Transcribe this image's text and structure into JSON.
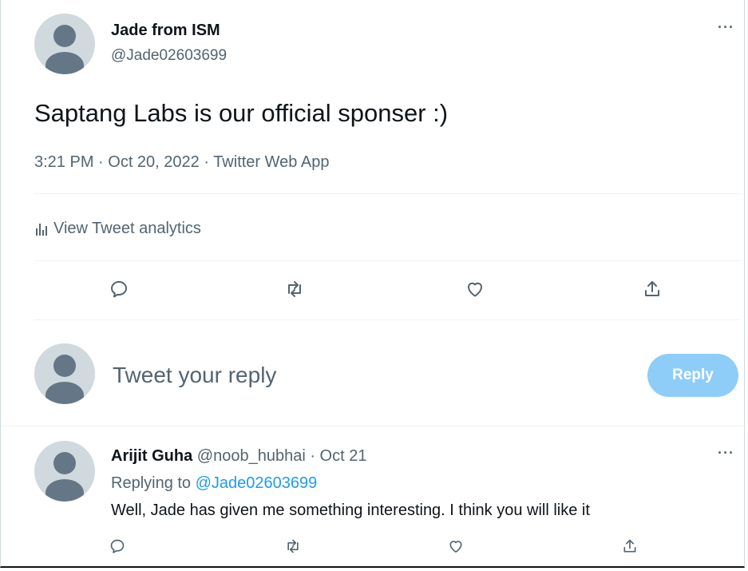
{
  "tweet": {
    "author_name": "Jade from ISM",
    "author_handle": "@Jade02603699",
    "text": "Saptang Labs is our official sponser :)",
    "meta": "3:21 PM · Oct 20, 2022 · Twitter Web App",
    "analytics_label": "View Tweet analytics",
    "more_label": "···"
  },
  "reply_composer": {
    "placeholder": "Tweet your reply",
    "button_label": "Reply"
  },
  "reply": {
    "author_name": "Arijit Guha",
    "author_handle": "@noob_hubhai",
    "date": "· Oct 21",
    "replying_prefix": "Replying to",
    "replying_to": "@Jade02603699",
    "text": "Well, Jade has given me something interesting. I think you will like it",
    "more_label": "···"
  },
  "icons": {
    "reply": "reply-icon",
    "retweet": "retweet-icon",
    "like": "heart-icon",
    "share": "share-icon",
    "analytics": "bar-chart-icon"
  },
  "colors": {
    "accent": "#1d9bf0",
    "reply_button_disabled": "#8ecdf8",
    "secondary_text": "#536471",
    "avatar_bg": "#cfd9de",
    "avatar_fg": "#657786"
  }
}
